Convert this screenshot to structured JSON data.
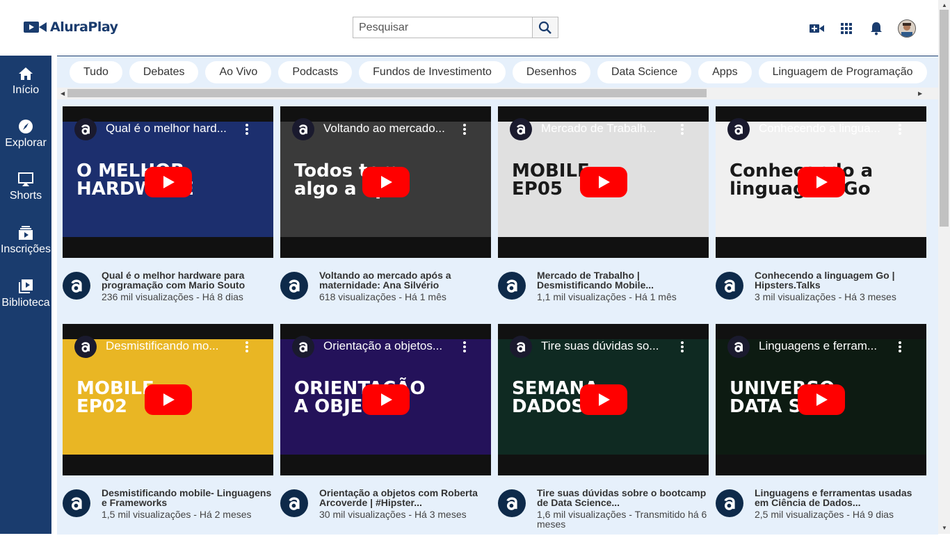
{
  "app": {
    "name": "AluraPlay"
  },
  "search": {
    "placeholder": "Pesquisar"
  },
  "sidebar": {
    "items": [
      {
        "label": "Início",
        "icon": "home-icon"
      },
      {
        "label": "Explorar",
        "icon": "compass-icon"
      },
      {
        "label": "Shorts",
        "icon": "shorts-icon"
      },
      {
        "label": "Inscrições",
        "icon": "subscriptions-icon"
      },
      {
        "label": "Biblioteca",
        "icon": "library-icon"
      }
    ]
  },
  "chips": [
    "Tudo",
    "Debates",
    "Ao Vivo",
    "Podcasts",
    "Fundos de Investimento",
    "Desenhos",
    "Data Science",
    "Apps",
    "Linguagem de Programação"
  ],
  "videos": [
    {
      "thumb_title": "Qual é o melhor hard...",
      "thumb_text": "O MELHOR\nHARDWARE",
      "title": "Qual é o melhor hardware para programação com Mario Souto",
      "sub": "236 mil visualizações - Há 8 dias",
      "bg": "#1c2f6e"
    },
    {
      "thumb_title": "Voltando ao mercado...",
      "thumb_text": "Todos tem\nalgo a apre",
      "title": "Voltando ao mercado após a maternidade: Ana Silvério",
      "sub": "618 visualizações - Há 1 mês",
      "bg": "#3a3a3a"
    },
    {
      "thumb_title": "Mercado de Trabalh...",
      "thumb_text": "MOBILE\nEP05",
      "title": "Mercado de Trabalho | Desmistificando Mobile...",
      "sub": "1,1 mil visualizações - Há 1 mês",
      "bg": "#e0e0e0"
    },
    {
      "thumb_title": "Conhecendo a lingua...",
      "thumb_text": "Conhecendo a\nlinguagem Go",
      "title": "Conhecendo a linguagem Go | Hipsters.Talks",
      "sub": "3 mil visualizações - Há 3 meses",
      "bg": "#f0f0f0"
    },
    {
      "thumb_title": "Desmistificando mo...",
      "thumb_text": "MOBILE\nEP02",
      "title": "Desmistificando mobile- Linguagens e Frameworks",
      "sub": "1,5 mil visualizações - Há 2 meses",
      "bg": "#e9b624"
    },
    {
      "thumb_title": "Orientação a objetos...",
      "thumb_text": "ORIENTAÇÃO\nA OBJETOS",
      "title": "Orientação a objetos com Roberta Arcoverde | #Hipster...",
      "sub": "30 mil visualizações - Há 3 meses",
      "bg": "#24125a"
    },
    {
      "thumb_title": "Tire suas dúvidas so...",
      "thumb_text": "SEMANA\nDADOS",
      "title": "Tire suas dúvidas sobre o bootcamp de Data Science...",
      "sub": "1,6 mil visualizações - Transmitido há 6 meses",
      "bg": "#0f2a22"
    },
    {
      "thumb_title": "Linguagens e ferram...",
      "thumb_text": "UNIVERSO\nDATA SC",
      "title": "Linguagens e ferramentas usadas em Ciência de Dados...",
      "sub": "2,5 mil visualizações - Há 9 dias",
      "bg": "#0d1b12"
    }
  ],
  "colors": {
    "brand": "#1a3c6e",
    "main_bg": "#e6f0fb",
    "play": "#ff0000"
  }
}
